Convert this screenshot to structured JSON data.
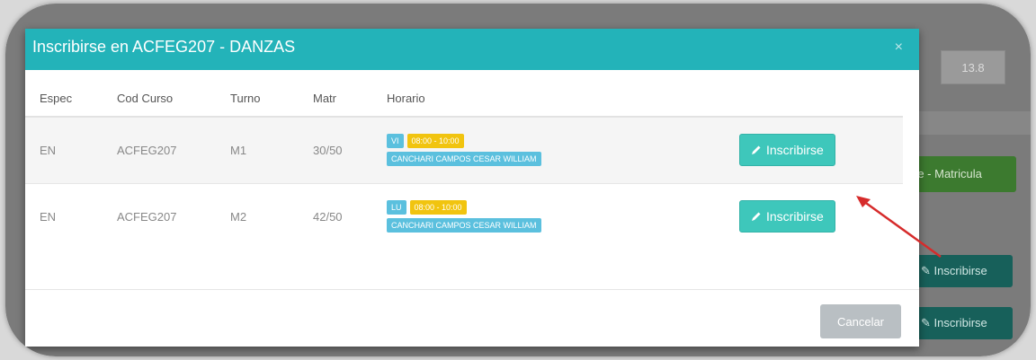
{
  "background": {
    "input_value": "13.8",
    "green_button_label": "re - Matricula",
    "row_button_label": "Inscribirse"
  },
  "modal": {
    "title": "Inscribirse en ACFEG207 - DANZAS",
    "close_label": "×",
    "columns": [
      "Espec",
      "Cod Curso",
      "Turno",
      "Matr",
      "Horario"
    ],
    "rows": [
      {
        "espec": "EN",
        "cod_curso": "ACFEG207",
        "turno": "M1",
        "matr": "30/50",
        "day": "VI",
        "time": "08:00 - 10:00",
        "professor": "CANCHARI CAMPOS CESAR WILLIAM",
        "button": "Inscribirse"
      },
      {
        "espec": "EN",
        "cod_curso": "ACFEG207",
        "turno": "M2",
        "matr": "42/50",
        "day": "LU",
        "time": "08:00 - 10:00",
        "professor": "CANCHARI CAMPOS CESAR WILLIAM",
        "button": "Inscribirse"
      }
    ],
    "cancel_label": "Cancelar"
  },
  "colors": {
    "header": "#23b3b9",
    "button": "#3ec7bb",
    "arrow": "#d62b2b"
  }
}
